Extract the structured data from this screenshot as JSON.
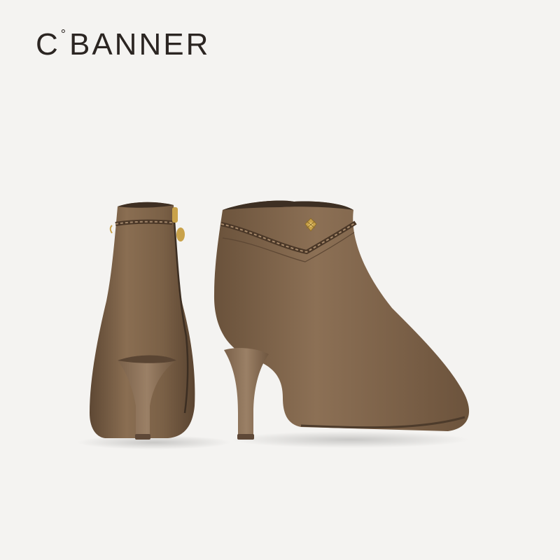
{
  "brand": {
    "logo_prefix": "C",
    "logo_mark": "°",
    "logo_rest": "BANNER"
  },
  "product_image": {
    "colors": {
      "background": "#f4f3f1",
      "leather": "#7a6147",
      "leather_dark": "#5a4532",
      "leather_light": "#927659",
      "hardware": "#c9a24a"
    }
  }
}
